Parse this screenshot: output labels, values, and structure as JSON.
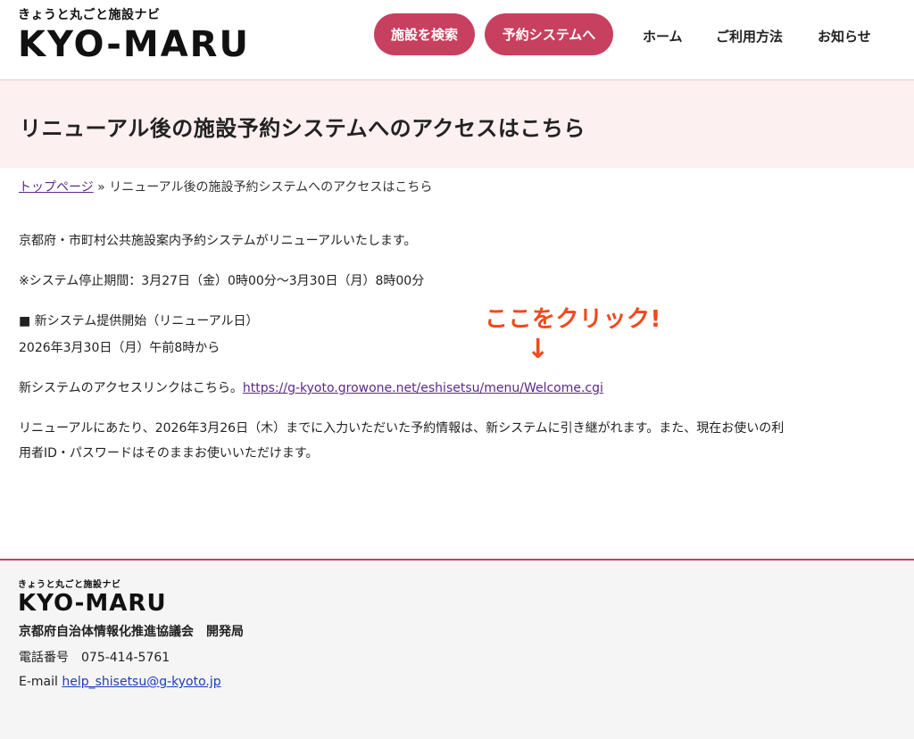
{
  "header": {
    "logo_tagline": "きょうと丸ごと施設ナビ",
    "logo_text": "KYO-MARU",
    "nav_buttons": {
      "search": "施設を検索",
      "reserve": "予約システムへ"
    },
    "nav_links": {
      "home": "ホーム",
      "usage": "ご利用方法",
      "news": "お知らせ"
    }
  },
  "page": {
    "title": "リニューアル後の施設予約システムへのアクセスはこちら"
  },
  "breadcrumb": {
    "home": "トップページ",
    "separator": " » ",
    "current": "リニューアル後の施設予約システムへのアクセスはこちら"
  },
  "content": {
    "p1": "京都府・市町村公共施設案内予約システムがリニューアルいたします。",
    "p2": "※システム停止期間：3月27日（金）0時00分〜3月30日（月）8時00分",
    "p3": "■ 新システム提供開始（リニューアル日）",
    "p4": "2026年3月30日（月）午前8時から",
    "p5_prefix": "新システムのアクセスリンクはこちら。",
    "p5_link": "https://g-kyoto.growone.net/eshisetsu/menu/Welcome.cgi",
    "p6": "リニューアルにあたり、2026年3月26日（木）までに入力いただいた予約情報は、新システムに引き継がれます。また、現在お使いの利",
    "p7": "用者ID・パスワードはそのままお使いいただけます。",
    "callout": "ここをクリック!",
    "arrow": "↓"
  },
  "footer": {
    "logo_tagline": "きょうと丸ごと施設ナビ",
    "logo_text": "KYO-MARU",
    "org": "京都府自治体情報化推進協議会　開発局",
    "tel": "電話番号　075-414-5761",
    "mail_label": "E-mail ",
    "mail": "help_shisetsu@g-kyoto.jp"
  },
  "colors": {
    "accent": "#c8405f",
    "title_band": "#fdf0f1",
    "callout": "#f04a1c",
    "link": "#5b2a86"
  }
}
